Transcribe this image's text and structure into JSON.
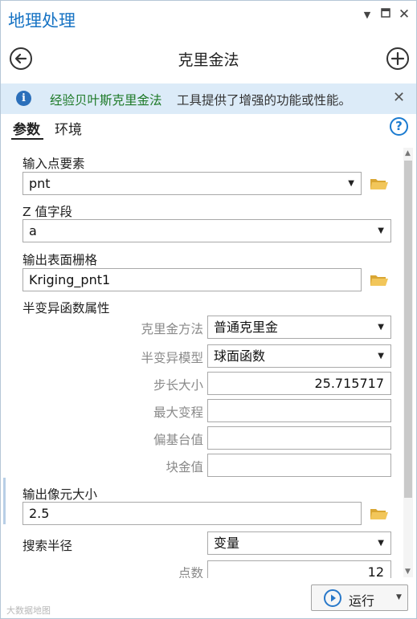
{
  "pane": {
    "title": "地理处理"
  },
  "tool": {
    "title": "克里金法"
  },
  "banner": {
    "link_text": "经验贝叶斯克里金法",
    "text": "工具提供了增强的功能或性能。"
  },
  "tabs": {
    "parameters": "参数",
    "environments": "环境"
  },
  "params": {
    "input_points_label": "输入点要素",
    "input_points_value": "pnt",
    "z_field_label": "Z 值字段",
    "z_field_value": "a",
    "output_raster_label": "输出表面栅格",
    "output_raster_value": "Kriging_pnt1",
    "semivariogram_label": "半变异函数属性",
    "kriging_method_label": "克里金方法",
    "kriging_method_value": "普通克里金",
    "semivariogram_model_label": "半变异模型",
    "semivariogram_model_value": "球面函数",
    "lag_size_label": "步长大小",
    "lag_size_value": "25.715717",
    "major_range_label": "最大变程",
    "major_range_value": "",
    "partial_sill_label": "偏基台值",
    "partial_sill_value": "",
    "nugget_label": "块金值",
    "nugget_value": "",
    "cell_size_label": "输出像元大小",
    "cell_size_value": "2.5",
    "search_radius_label": "搜索半径",
    "search_radius_value": "变量",
    "points_label": "点数",
    "points_value": "12"
  },
  "run": {
    "label": "运行"
  },
  "watermark": "大数据地图",
  "icons": {
    "back": "back-arrow-icon",
    "add": "add-icon",
    "info": "info-icon",
    "help": "help-icon",
    "folder": "folder-icon",
    "run": "play-icon"
  },
  "colors": {
    "title_blue": "#1874c4",
    "banner_bg": "#dcebf8",
    "link_green": "#1e7a28",
    "folder_yellow": "#e8b84a"
  }
}
